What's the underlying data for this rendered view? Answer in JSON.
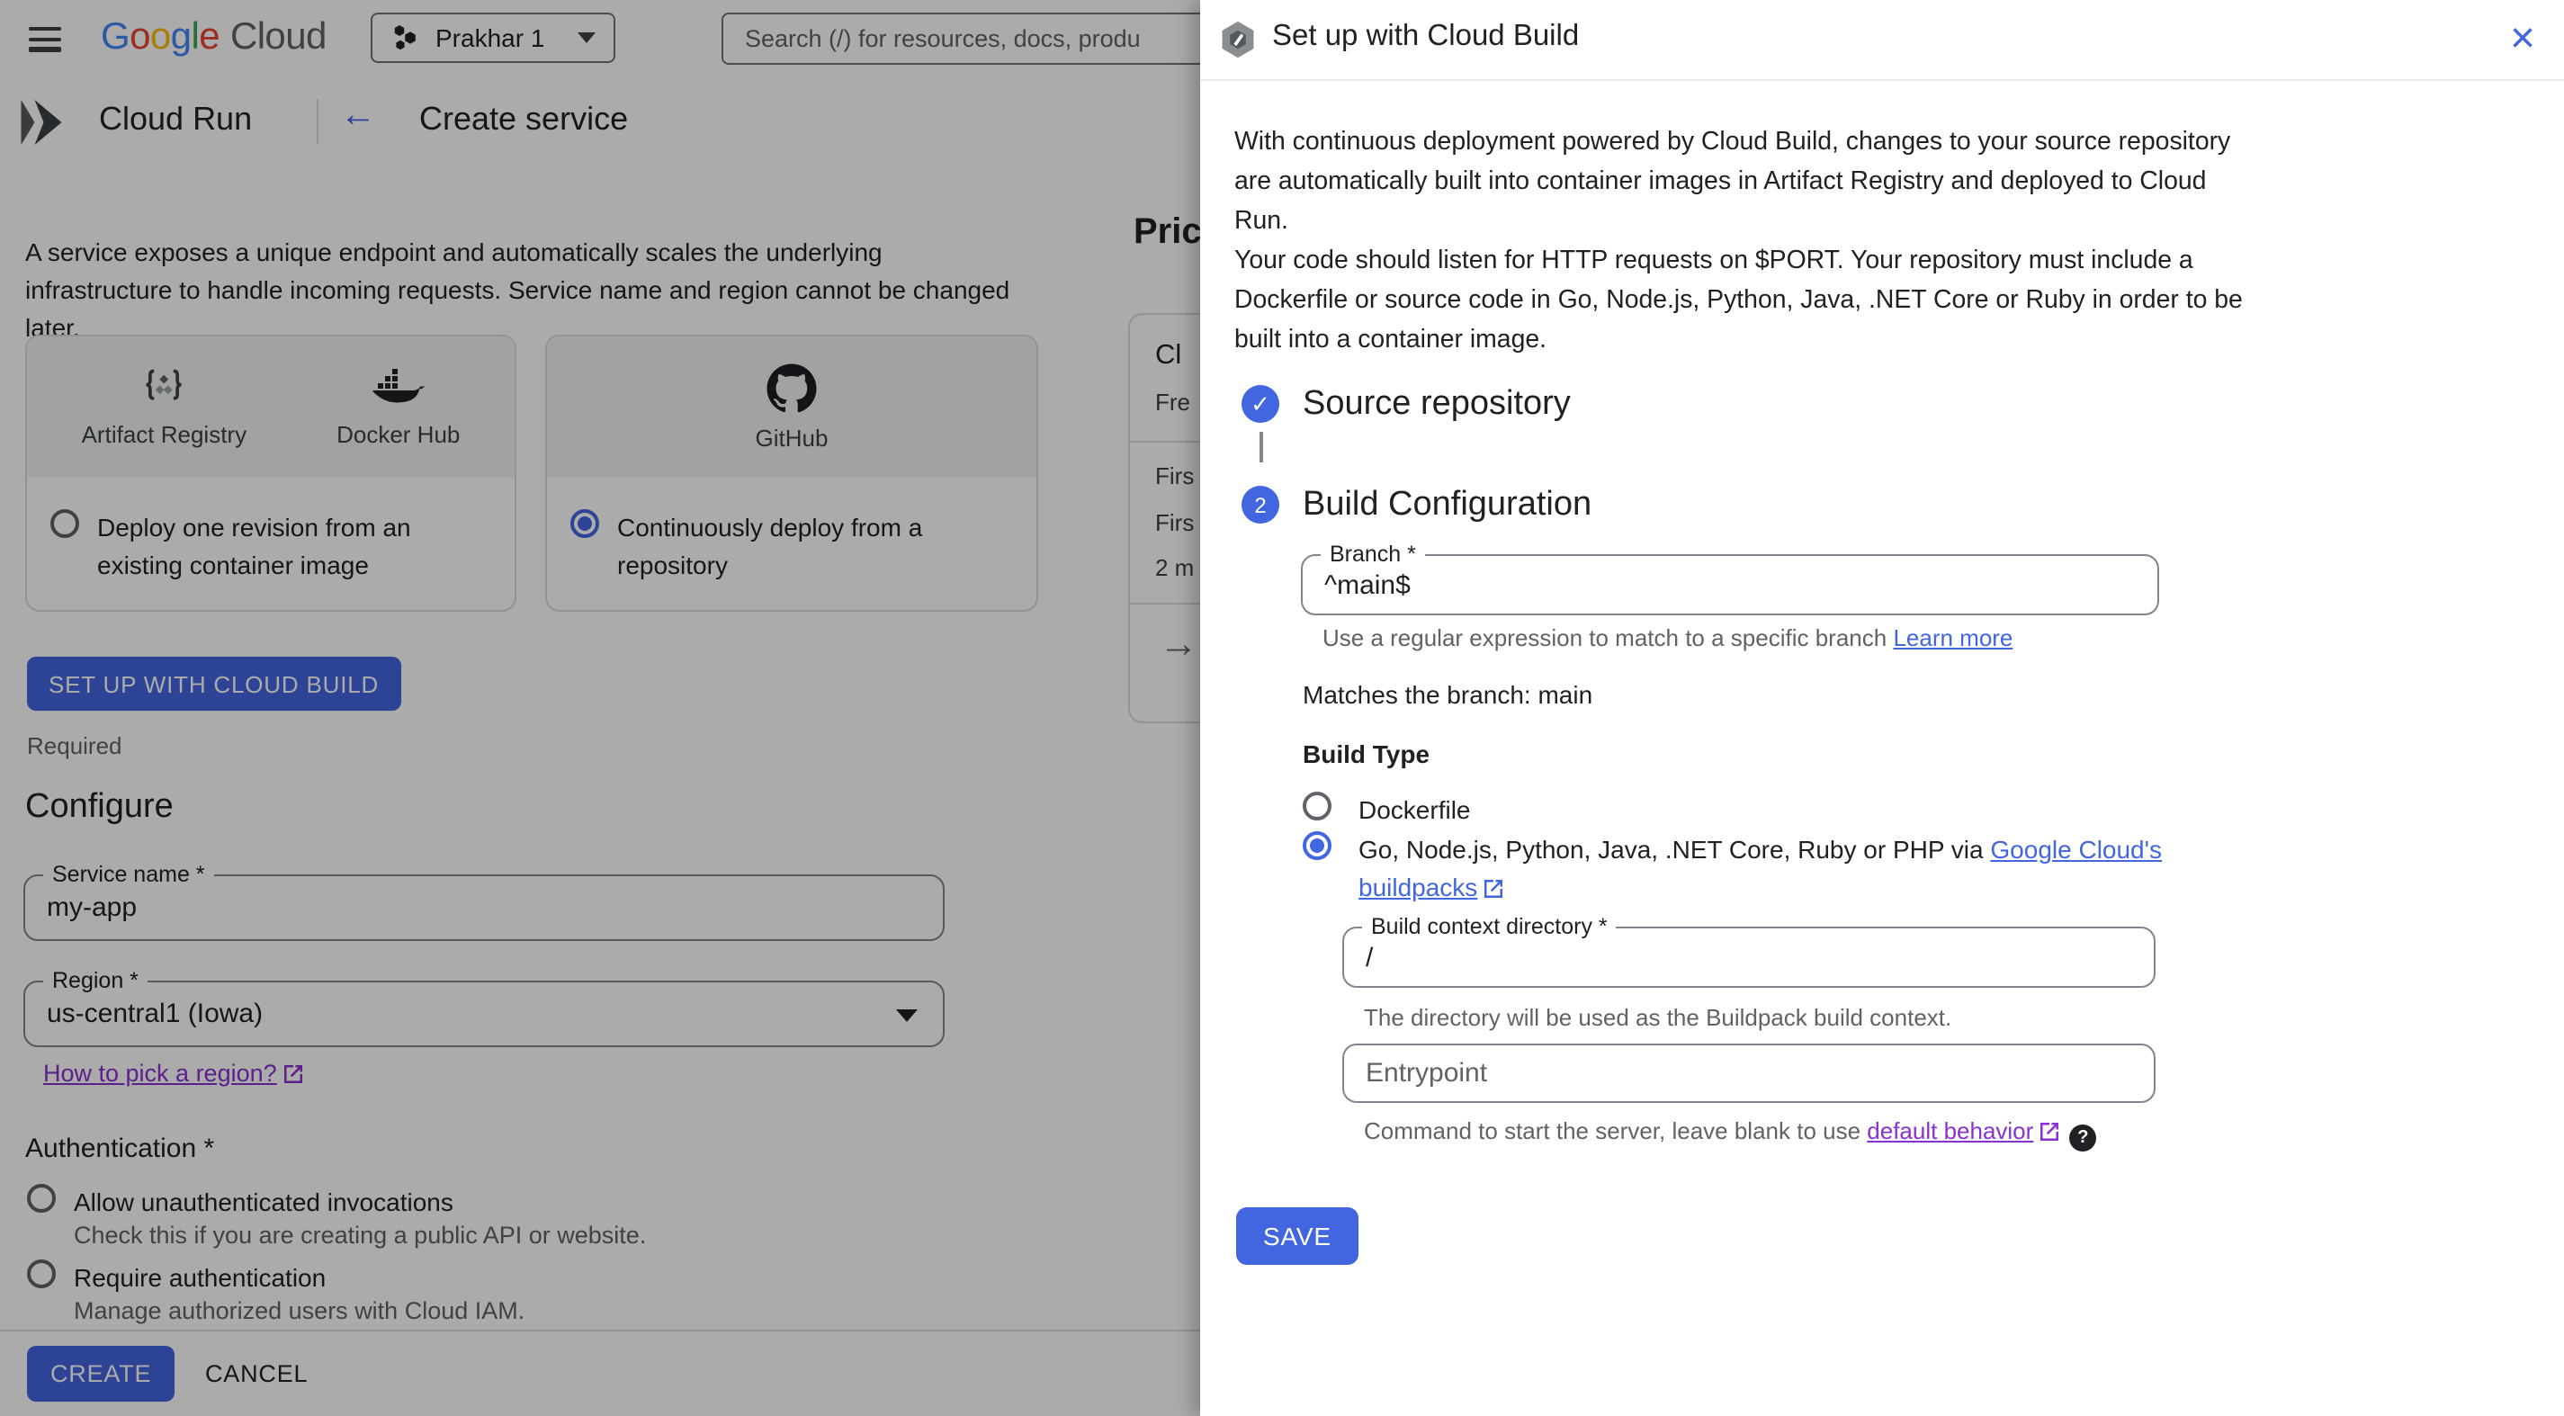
{
  "colors": {
    "accent_blue": "#4265e0",
    "visited_link_purple": "#8a30d0",
    "text_primary": "#202124",
    "text_secondary": "#5f6368",
    "scrim": "rgba(0,0,0,0.33)",
    "card_header_bg": "#f1f3f4",
    "google_blue": "#4285f4",
    "google_red": "#ea4335",
    "google_yellow": "#fbbc05",
    "google_green": "#34a853"
  },
  "icons": {
    "close": "×",
    "back_arrow": "←",
    "check": "✓",
    "help": "?",
    "pricing_arrow": "→",
    "names": [
      "menu-icon",
      "google-cloud-logo",
      "project-icon",
      "chevron-down-icon",
      "cloud-run-icon",
      "artifact-registry-icon",
      "docker-hub-icon",
      "github-icon",
      "cloud-build-icon",
      "close-icon",
      "external-link-icon",
      "help-icon",
      "check-icon",
      "arrow-right-icon"
    ]
  },
  "header": {
    "logo": {
      "letters": [
        {
          "ch": "G"
        },
        {
          "ch": "o"
        },
        {
          "ch": "o"
        },
        {
          "ch": "g"
        },
        {
          "ch": "l"
        },
        {
          "ch": "e"
        }
      ],
      "cloud": "Cloud"
    },
    "project_selector": {
      "label": "Prakhar 1"
    },
    "search": {
      "placeholder": "Search (/) for resources, docs, produ"
    }
  },
  "subheader": {
    "product": "Cloud Run",
    "page_title": "Create service"
  },
  "main": {
    "intro": "A service exposes a unique endpoint and automatically scales the underlying\ninfrastructure to handle incoming requests. Service name and region cannot be changed\nlater.",
    "cards": [
      {
        "icon_labels": [
          "Artifact Registry",
          "Docker Hub"
        ],
        "radio_label": "Deploy one revision from an\nexisting container image",
        "selected": false
      },
      {
        "icon_labels": [
          "GitHub"
        ],
        "radio_label": "Continuously deploy from a\nrepository",
        "selected": true
      }
    ],
    "setup_button": "SET UP WITH CLOUD BUILD",
    "required_note": "Required",
    "configure": {
      "title": "Configure",
      "service_name": {
        "label": "Service name *",
        "value": "my-app"
      },
      "region": {
        "label": "Region *",
        "value": "us-central1 (Iowa)"
      },
      "region_link": "How to pick a region?"
    },
    "authentication": {
      "title": "Authentication *",
      "option1": {
        "label": "Allow unauthenticated invocations",
        "desc": "Check this if you are creating a public API or website.",
        "selected": false
      },
      "option2": {
        "label": "Require authentication",
        "desc": "Manage authorized users with Cloud IAM.",
        "selected": false
      }
    },
    "footer": {
      "create": "CREATE",
      "cancel": "CANCEL"
    }
  },
  "pricing_strip": {
    "title": "Pric",
    "card": {
      "line1": "Cl",
      "line2": "Fre",
      "line3": "Firs",
      "line4": "Firs",
      "line5": "2 m"
    }
  },
  "panel": {
    "title": "Set up with Cloud Build",
    "intro": "With continuous deployment powered by Cloud Build, changes to your source repository\nare automatically built into container images in Artifact Registry and deployed to Cloud\nRun.\nYour code should listen for HTTP requests on $PORT. Your repository must include a\nDockerfile or source code in Go, Node.js, Python, Java, .NET Core or Ruby in order to be\nbuilt into a container image.",
    "steps": [
      {
        "title": "Source repository",
        "state": "complete"
      },
      {
        "number": "2",
        "title": "Build Configuration",
        "state": "active"
      }
    ],
    "branch": {
      "label": "Branch *",
      "value": "^main$",
      "helper": "Use a regular expression to match to a specific branch ",
      "helper_link": "Learn more"
    },
    "matches_text": "Matches the branch: main",
    "build_type": {
      "label": "Build Type",
      "option1": {
        "label": "Dockerfile",
        "selected": false
      },
      "option2": {
        "prefix": "Go, Node.js, Python, Java, .NET Core, Ruby or PHP via ",
        "link_line1": "Google Cloud's",
        "link_line2": "buildpacks",
        "selected": true
      }
    },
    "build_context": {
      "label": "Build context directory *",
      "value": "/",
      "helper": "The directory will be used as the Buildpack build context."
    },
    "entrypoint": {
      "placeholder": "Entrypoint",
      "helper": "Command to start the server, leave blank to use ",
      "helper_link": "default behavior"
    },
    "save_button": "SAVE"
  }
}
